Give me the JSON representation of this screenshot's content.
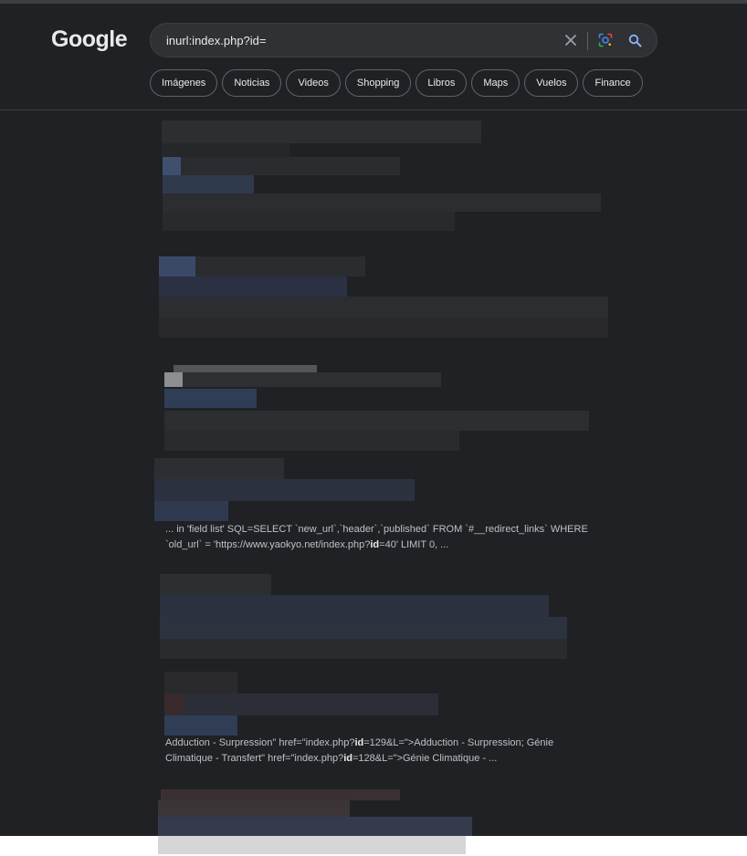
{
  "header": {
    "logo_text": "Google",
    "search_query": "inurl:index.php?id="
  },
  "icons": [
    "close-icon",
    "google-lens-icon",
    "search-icon"
  ],
  "chips": [
    "Imágenes",
    "Noticias",
    "Videos",
    "Shopping",
    "Libros",
    "Maps",
    "Vuelos",
    "Finance"
  ],
  "results": [
    {
      "snippet_line1": "... in 'field list' SQL=SELECT `new_url`,`header`,`published` FROM `#__redirect_links` WHERE",
      "snippet_line2_pre": "`old_url` = 'https://www.yaokyo.net/index.php?",
      "snippet_line2_bold": "id",
      "snippet_line2_post": "=40' LIMIT 0, ..."
    },
    {
      "snippet_line1_pre": "Adduction - Surpression\" href=\"index.php?",
      "snippet_line1_bold": "id",
      "snippet_line1_post": "=129&L=\">Adduction - Surpression; Génie",
      "snippet_line2_pre": "Climatique - Transfert\" href=\"index.php?",
      "snippet_line2_bold": "id",
      "snippet_line2_post": "=128&L=\">Génie Climatique - ..."
    }
  ],
  "colors": {
    "background": "#202124",
    "search_bg": "#303134",
    "text": "#bdc1c6",
    "blur_dark": "#2a2b2e",
    "blur_blue": "#3c4f6e"
  }
}
